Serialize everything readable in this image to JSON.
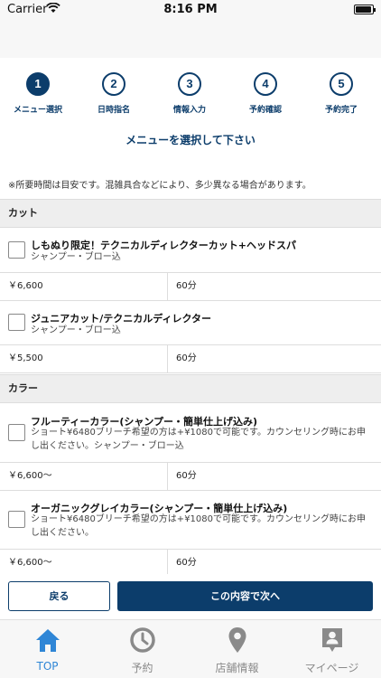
{
  "status_bar": {
    "carrier": "Carrier",
    "time": "8:16 PM"
  },
  "steps": [
    {
      "number": "1",
      "label": "メニュー選択"
    },
    {
      "number": "2",
      "label": "日時指名"
    },
    {
      "number": "3",
      "label": "情報入力"
    },
    {
      "number": "4",
      "label": "予約確認"
    },
    {
      "number": "5",
      "label": "予約完了"
    }
  ],
  "page_title": "メニューを選択して下さい",
  "notice": "※所要時間は目安です。混雑具合などにより、多少異なる場合があります。",
  "sections": [
    {
      "name": "カット",
      "items": [
        {
          "name": "しもぬり限定！テクニカルディレクターカット+ヘッドスパ",
          "description": "シャンプー・ブロー込",
          "price": "￥6,600",
          "duration": "60分"
        },
        {
          "name": "ジュニアカット/テクニカルディレクター",
          "description": "シャンプー・ブロー込",
          "price": "￥5,500",
          "duration": "60分"
        }
      ]
    },
    {
      "name": "カラー",
      "items": [
        {
          "name": "フルーティーカラー(シャンプー・簡単仕上げ込み)",
          "description": "ショート¥6480ブリーチ希望の方は+¥1080で可能です。カウンセリング時にお申し出ください。シャンプー・ブロー込",
          "price": "￥6,600〜",
          "duration": "60分"
        },
        {
          "name": "オーガニックグレイカラー(シャンプー・簡単仕上げ込み)",
          "description": "ショート¥6480ブリーチ希望の方は+¥1080で可能です。カウンセリング時にお申し出ください。",
          "price": "￥6,600〜",
          "duration": "60分"
        }
      ]
    }
  ],
  "actions": {
    "back_label": "戻る",
    "next_label": "この内容で次へ"
  },
  "tabbar": [
    {
      "label": "TOP",
      "icon": "home-icon"
    },
    {
      "label": "予約",
      "icon": "clock-icon"
    },
    {
      "label": "店舗情報",
      "icon": "map-pin-icon"
    },
    {
      "label": "マイページ",
      "icon": "person-badge-icon"
    }
  ],
  "colors": {
    "primary": "#0c3d6b",
    "tab_active": "#2f86d6",
    "tab_inactive": "#8a8a8a"
  }
}
